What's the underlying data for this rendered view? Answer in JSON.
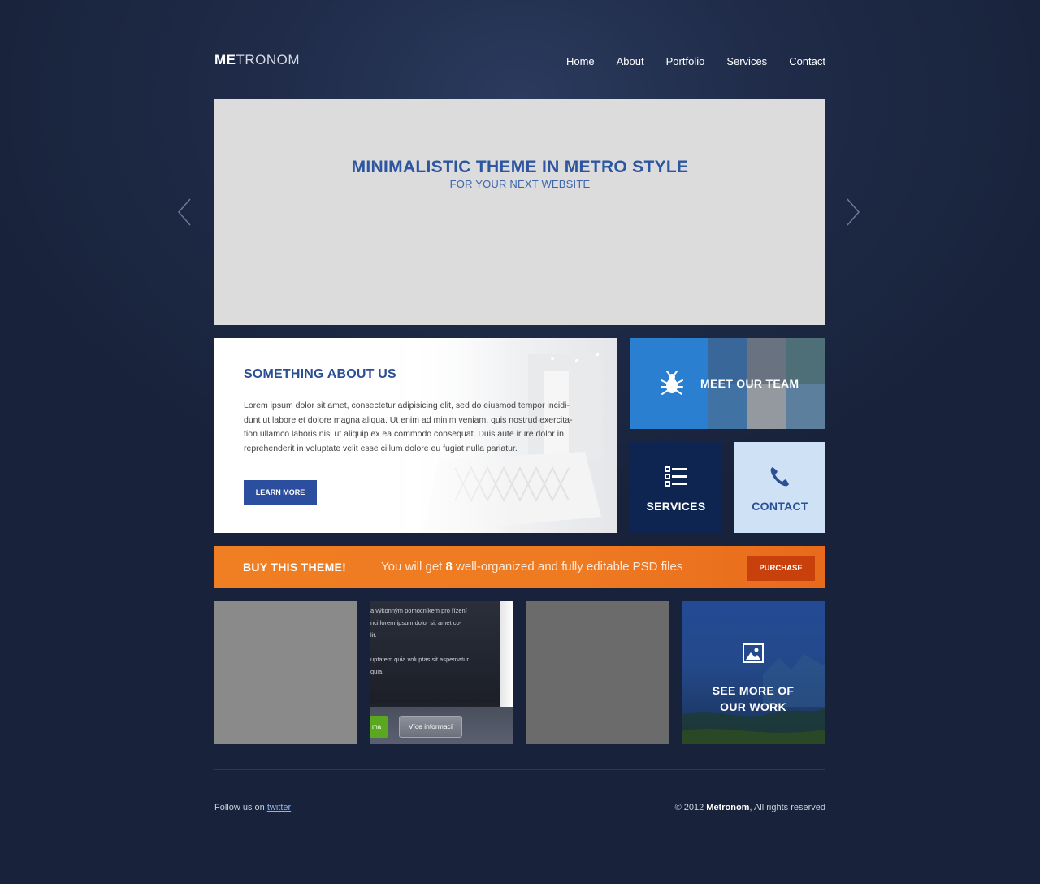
{
  "header": {
    "logo_bold": "ME",
    "logo_rest": "TRONOM",
    "nav": [
      "Home",
      "About",
      "Portfolio",
      "Services",
      "Contact"
    ]
  },
  "slider": {
    "title": "MINIMALISTIC THEME IN METRO STYLE",
    "subtitle": "FOR YOUR NEXT WEBSITE",
    "prev_icon": "chevron-left-icon",
    "next_icon": "chevron-right-icon"
  },
  "about": {
    "heading": "SOMETHING ABOUT US",
    "body": "Lorem ipsum dolor sit amet, consectetur adipisicing elit, sed do eiusmod tempor incidi-dunt ut labore et dolore magna aliqua. Ut enim ad minim veniam, quis nostrud exercita-tion ullamco laboris nisi ut aliquip ex ea commodo consequat. Duis aute irure dolor in reprehenderit in voluptate velit esse cillum dolore eu fugiat nulla pariatur.",
    "button": "LEARN MORE"
  },
  "tiles": {
    "team": {
      "label": "MEET OUR TEAM",
      "icon": "bug-icon",
      "color": "#2a7fd1"
    },
    "services": {
      "label": "SERVICES",
      "icon": "list-icon",
      "color": "#0d2550"
    },
    "contact": {
      "label": "CONTACT",
      "icon": "phone-icon",
      "color": "#cfe1f5"
    }
  },
  "promo": {
    "headline": "BUY THIS THEME!",
    "msg_before": "You will get ",
    "msg_count": "8",
    "msg_after": " well-organized and fully editable PSD files",
    "button": "PURCHASE",
    "color": "#f07e22"
  },
  "portfolio": {
    "item2": {
      "lines": [
        "a výkonným pomocníkem pro řízení",
        "nci lorem ipsum dolor sit amet co-",
        "lit.",
        "",
        "uptatem quia voluptas sit aspernatur",
        "quia."
      ],
      "green_button": "ma",
      "button": "Více informací"
    },
    "more": {
      "line1": "SEE MORE OF",
      "line2": "OUR WORK",
      "icon": "image-icon"
    }
  },
  "footer": {
    "follow_text": "Follow us on ",
    "twitter_link": "twitter",
    "copyright_prefix": "© 2012 ",
    "copyright_brand": "Metronom",
    "copyright_suffix": ", All rights reserved"
  }
}
